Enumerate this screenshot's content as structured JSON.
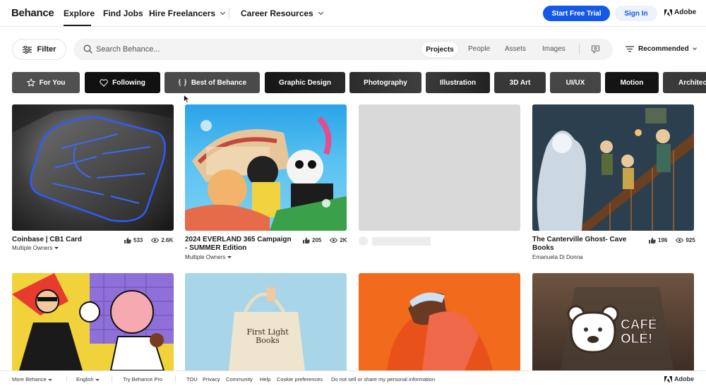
{
  "header": {
    "logo": "Behance",
    "nav": [
      {
        "label": "Explore"
      },
      {
        "label": "Find Jobs"
      },
      {
        "label": "Hire Freelancers"
      },
      {
        "label": "Career Resources"
      }
    ],
    "trial_label": "Start Free Trial",
    "signin_label": "Sign In",
    "adobe_label": "Adobe",
    "accent": "#1458e8"
  },
  "search": {
    "filter_label": "Filter",
    "placeholder": "Search Behance...",
    "scopes": [
      "Projects",
      "People",
      "Assets",
      "Images"
    ],
    "active_scope": "Projects",
    "sort_label": "Recommended"
  },
  "categories": [
    {
      "label": "For You",
      "icon": "star-icon"
    },
    {
      "label": "Following",
      "icon": "heart-icon"
    },
    {
      "label": "Best of Behance",
      "icon": "laurel-icon"
    },
    {
      "label": "Graphic Design"
    },
    {
      "label": "Photography"
    },
    {
      "label": "Illustration"
    },
    {
      "label": "3D Art"
    },
    {
      "label": "UI/UX"
    },
    {
      "label": "Motion"
    },
    {
      "label": "Architec"
    }
  ],
  "projects": [
    {
      "title": "Coinbase | CB1 Card",
      "owner": "Multiple Owners",
      "likes": "533",
      "views": "2.6K"
    },
    {
      "title": "2024 EVERLAND 365 Campaign - SUMMER Edition",
      "owner": "Multiple Owners",
      "likes": "205",
      "views": "2K"
    },
    {
      "title": "",
      "owner": "",
      "likes": "",
      "views": ""
    },
    {
      "title": "The Canterville Ghost- Cave Books",
      "owner": "Emanuela Di Donna",
      "likes": "196",
      "views": "925"
    }
  ],
  "second_row": [
    {
      "icon": "comic-illustration"
    },
    {
      "text": "First Light Books"
    },
    {
      "icon": "hooded-figure-illustration"
    },
    {
      "text": "CAFÉ OLÉ!"
    }
  ],
  "footer": {
    "items": [
      "More Behance",
      "English",
      "Try Behance Pro",
      "TOU",
      "Privacy",
      "Community",
      "Help",
      "Cookie preferences",
      "Do not sell or share my personal information"
    ],
    "adobe_label": "Adobe"
  }
}
